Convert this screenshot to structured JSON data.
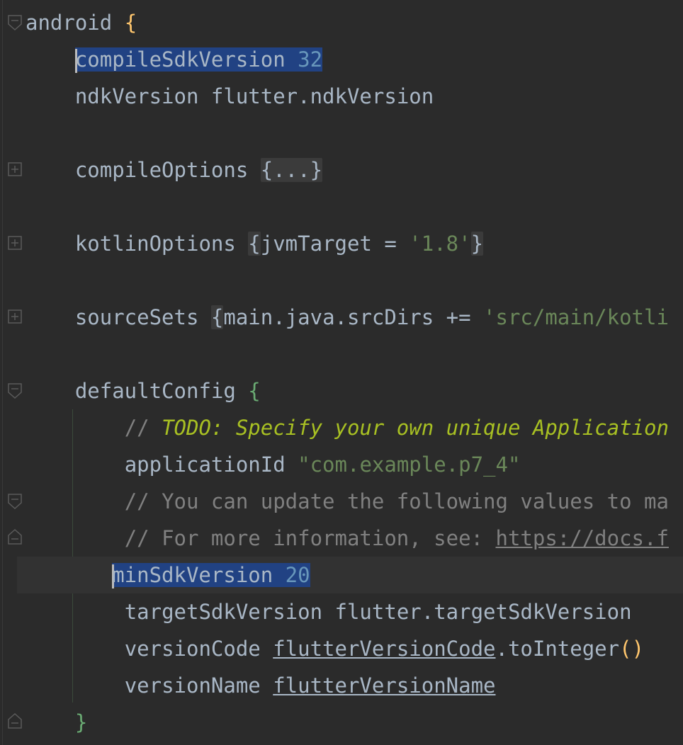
{
  "editor": {
    "lines": {
      "l1": {
        "ident": "android",
        "brace": "{"
      },
      "l2": {
        "ident": "compileSdkVersion",
        "value": "32"
      },
      "l3": {
        "ident": "ndkVersion",
        "value": "flutter.ndkVersion"
      },
      "l5": {
        "ident": "compileOptions",
        "folded": "{...}"
      },
      "l7": {
        "ident": "kotlinOptions",
        "open": "{",
        "body": "jvmTarget = ",
        "str": "'1.8'",
        "close": "}"
      },
      "l9": {
        "ident": "sourceSets",
        "open": "{",
        "body": "main.java.srcDirs += ",
        "str": "'src/main/kotli"
      },
      "l11": {
        "ident": "defaultConfig",
        "brace": "{"
      },
      "l12": {
        "slashes": "// ",
        "todo": "TODO: Specify your own unique Application"
      },
      "l13": {
        "ident": "applicationId",
        "str": "\"com.example.p7_4\""
      },
      "l14": {
        "comment": "// You can update the following values to ma"
      },
      "l15": {
        "comment": "// For more information, see: ",
        "link": "https://docs.f"
      },
      "l16": {
        "ident": "minSdkVersion",
        "value": "20"
      },
      "l17": {
        "ident": "targetSdkVersion",
        "value": "flutter.targetSdkVersion"
      },
      "l18": {
        "ident": "versionCode",
        "ref": "flutterVersionCode",
        "call": ".toInteger",
        "parens": "()"
      },
      "l19": {
        "ident": "versionName",
        "ref": "flutterVersionName"
      },
      "l20": {
        "brace": "}"
      }
    }
  }
}
